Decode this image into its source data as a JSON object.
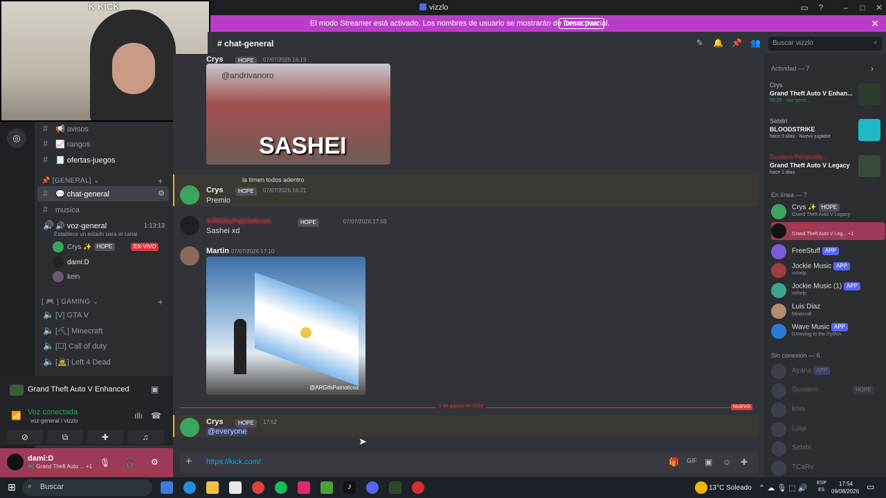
{
  "app": {
    "title": "vizzlo"
  },
  "banner": {
    "message": "El modo Streamer está activado. Los nombres de usuario se mostrarán de forma parcial.",
    "button": "Desactivar"
  },
  "webcam": {
    "overlay": "K KICK"
  },
  "channels": {
    "items": [
      {
        "icon": "#",
        "emoji": "📢",
        "label": "avisos"
      },
      {
        "icon": "#",
        "emoji": "📈",
        "label": "rangos"
      },
      {
        "icon": "#",
        "emoji": "🧾",
        "label": "ofertas-juegos"
      }
    ],
    "category_general": "[GENERAL]",
    "active_channel": "chat-general",
    "musica": "musica",
    "voice_channel": "voz-general",
    "voice_time": "1:13:13",
    "status_prompt": "Establece un estado para el canal",
    "voice_users": [
      {
        "name": "Crys",
        "tag": "HOPE",
        "live": "EN VIVO"
      },
      {
        "name": "dami:D"
      },
      {
        "name": "kein"
      }
    ],
    "category_gaming": "GAMING",
    "gaming": [
      {
        "code": "[V]",
        "label": "GTA V"
      },
      {
        "code": "[⛏]",
        "label": "Minecraft"
      },
      {
        "code": "[☐]",
        "label": "Call of duty"
      },
      {
        "code": "[🧟]",
        "label": "Left 4 Dead"
      }
    ]
  },
  "voice_panel": {
    "activity": "Grand Theft Auto V Enhanced",
    "status": "Voz conectada",
    "location": "voz-general / vizzlo"
  },
  "user_panel": {
    "name": "dami:D",
    "status": "Grand Theft Auto ...",
    "extra": "+1"
  },
  "chat": {
    "channel": "chat-general",
    "search_placeholder": "Buscar vizzlo",
    "messages": [
      {
        "author": "Crys",
        "tag": "HOPE",
        "time": "07/07/2026 16:19",
        "image_caption": "SASHEI",
        "image_watermark": "@andrivanoro"
      },
      {
        "reply_to": "la tirnen todos adentro",
        "author": "Crys",
        "tag": "HOPE",
        "time": "07/07/2026 16:21",
        "text": "Premio"
      },
      {
        "author": "ARGifsPatrioticos",
        "tag": "HOPE",
        "time": "07/07/2026 17:03",
        "text": "Sashei xd"
      },
      {
        "author": "Martin",
        "time": "07/07/2026 17:10",
        "image_watermark": "@ARGifsPatrioticos"
      },
      {
        "author": "Crys",
        "tag": "HOPE",
        "time": "17:52",
        "text": "@everyone"
      }
    ],
    "divider_date": "9 de agosto de 2026",
    "new_label": "NUEVO",
    "composer_value": "https://kick.com/"
  },
  "members": {
    "activity_header": "Actividad — 7",
    "activities": [
      {
        "user": "Crys",
        "game": "Grand Theft Auto V Enhan...",
        "detail": "59:26 · voz-gene..."
      },
      {
        "user": "Sebitri",
        "game": "BLOODSTRIKE",
        "detail": "hace 5 días · Nuevo jugador"
      },
      {
        "user": "Gustavo PeraltaMe...",
        "game": "Grand Theft Auto V Legacy",
        "detail": "hace 1 días"
      }
    ],
    "online_header": "En línea — 7",
    "online": [
      {
        "name": "Crys",
        "tag": "HOPE",
        "sub": "Grand Theft Auto V Legacy"
      },
      {
        "name": "dami:D",
        "sub": "Grand Theft Auto V Leg... +1"
      },
      {
        "name": "FreeStuff",
        "app": "APP"
      },
      {
        "name": "Jockie Music",
        "app": "APP",
        "sub": "m!help"
      },
      {
        "name": "Jockie Music (1)",
        "app": "APP",
        "sub": "m!help"
      },
      {
        "name": "Luis Diaz",
        "sub": "Minecraft"
      },
      {
        "name": "Wave Music",
        "app": "APP",
        "sub": "Grooving to the rhythm"
      }
    ],
    "offline_header": "Sin conexión — 6",
    "offline": [
      {
        "name": "Ayana",
        "app": "APP"
      },
      {
        "name": "Gustavo",
        "tag": "HOPE"
      },
      {
        "name": "kein"
      },
      {
        "name": "Luigi"
      },
      {
        "name": "Sebitri"
      },
      {
        "name": "TCaRv"
      }
    ]
  },
  "taskbar": {
    "search": "Buscar",
    "weather": "13°C Soleado",
    "lang": "ESP",
    "region": "ES",
    "time": "17:54",
    "date": "09/08/2026"
  },
  "colors": {
    "accent": "#5865f2",
    "banner": "#b83ec8",
    "live": "#da373c"
  }
}
